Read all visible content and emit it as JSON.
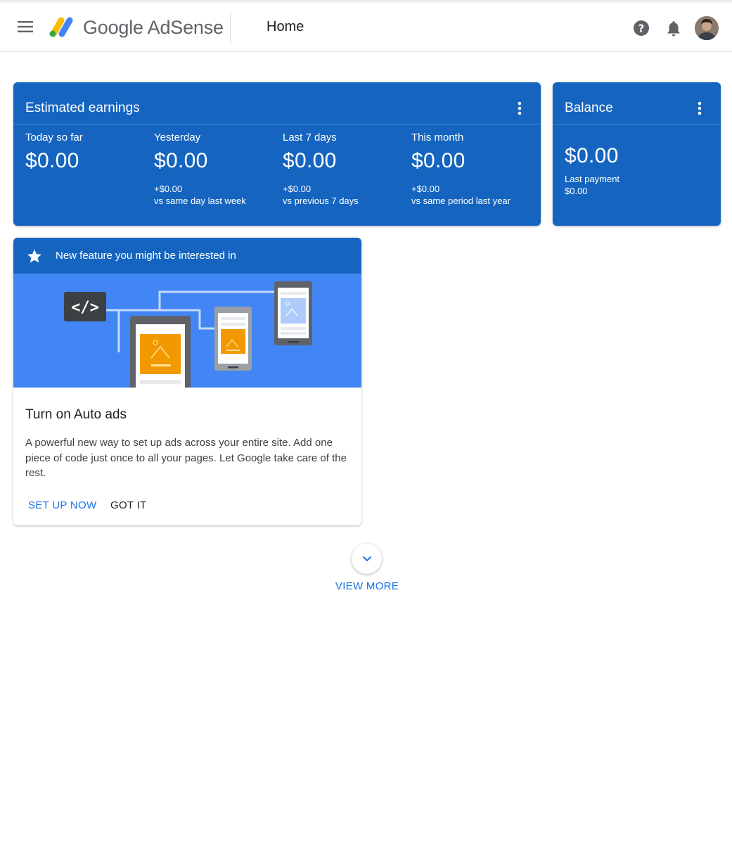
{
  "header": {
    "logo_text": "Google AdSense",
    "page_title": "Home"
  },
  "earnings": {
    "title": "Estimated earnings",
    "metrics": [
      {
        "label": "Today so far",
        "value": "$0.00",
        "delta": "",
        "sub": ""
      },
      {
        "label": "Yesterday",
        "value": "$0.00",
        "delta": "+$0.00",
        "sub": "vs same day last week"
      },
      {
        "label": "Last 7 days",
        "value": "$0.00",
        "delta": "+$0.00",
        "sub": "vs previous 7 days"
      },
      {
        "label": "This month",
        "value": "$0.00",
        "delta": "+$0.00",
        "sub": "vs same period last year"
      }
    ]
  },
  "balance": {
    "title": "Balance",
    "value": "$0.00",
    "last_payment_label": "Last payment",
    "last_payment_value": "$0.00"
  },
  "feature": {
    "banner": "New feature you might be interested in",
    "title": "Turn on Auto ads",
    "body": "A powerful new way to set up ads across your entire site. Add one piece of code just once to all your pages. Let Google take care of the rest.",
    "primary_action": "SET UP NOW",
    "secondary_action": "GOT IT"
  },
  "view_more": "VIEW MORE",
  "colors": {
    "card_blue": "#1565c0",
    "illustration_blue": "#4285f4",
    "link_blue": "#1a73e8"
  },
  "icons": [
    "menu-icon",
    "adsense-logo-icon",
    "help-icon",
    "bell-icon",
    "avatar",
    "more-vert-icon",
    "star-icon",
    "code-icon",
    "chevron-down-icon"
  ]
}
